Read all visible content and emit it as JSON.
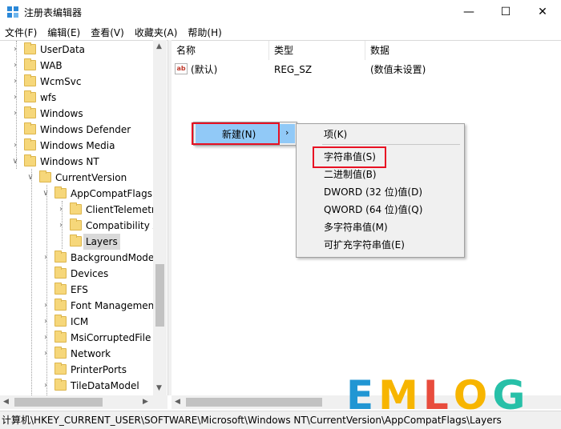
{
  "window": {
    "title": "注册表编辑器",
    "minimize": "—",
    "maximize": "☐",
    "close": "✕"
  },
  "menubar": [
    "文件(F)",
    "编辑(E)",
    "查看(V)",
    "收藏夹(A)",
    "帮助(H)"
  ],
  "tree": {
    "items": [
      {
        "label": "UserData",
        "state": "collapsed"
      },
      {
        "label": "WAB",
        "state": "collapsed"
      },
      {
        "label": "WcmSvc",
        "state": "collapsed"
      },
      {
        "label": "wfs",
        "state": "collapsed"
      },
      {
        "label": "Windows",
        "state": "collapsed"
      },
      {
        "label": "Windows Defender",
        "state": "none"
      },
      {
        "label": "Windows Media",
        "state": "collapsed"
      },
      {
        "label": "Windows NT",
        "state": "expanded"
      },
      {
        "label": "CurrentVersion",
        "state": "expanded"
      },
      {
        "label": "AppCompatFlags",
        "state": "expanded"
      },
      {
        "label": "ClientTelemetr",
        "state": "collapsed"
      },
      {
        "label": "Compatibility A",
        "state": "collapsed"
      },
      {
        "label": "Layers",
        "state": "selected"
      },
      {
        "label": "BackgroundMode",
        "state": "collapsed"
      },
      {
        "label": "Devices",
        "state": "none"
      },
      {
        "label": "EFS",
        "state": "none"
      },
      {
        "label": "Font Managemen",
        "state": "collapsed"
      },
      {
        "label": "ICM",
        "state": "collapsed"
      },
      {
        "label": "MsiCorruptedFile",
        "state": "collapsed"
      },
      {
        "label": "Network",
        "state": "collapsed"
      },
      {
        "label": "PrinterPorts",
        "state": "none"
      },
      {
        "label": "TileDataModel",
        "state": "collapsed"
      }
    ]
  },
  "list": {
    "columns": [
      "名称",
      "类型",
      "数据"
    ],
    "rows": [
      {
        "icon": "ab",
        "name": "(默认)",
        "type": "REG_SZ",
        "data": "(数值未设置)"
      }
    ]
  },
  "context_menu": {
    "new_label": "新建(N)",
    "arrow": "›"
  },
  "submenu": {
    "items": [
      "项(K)",
      "字符串值(S)",
      "二进制值(B)",
      "DWORD (32 位)值(D)",
      "QWORD (64 位)值(Q)",
      "多字符串值(M)",
      "可扩充字符串值(E)"
    ]
  },
  "statusbar": {
    "path": "计算机\\HKEY_CURRENT_USER\\SOFTWARE\\Microsoft\\Windows NT\\CurrentVersion\\AppCompatFlags\\Layers"
  },
  "watermark": {
    "letters": [
      {
        "char": "E",
        "color": "#2196d3"
      },
      {
        "char": "M",
        "color": "#f7b500"
      },
      {
        "char": "L",
        "color": "#e84c3d"
      },
      {
        "char": "O",
        "color": "#f7b500"
      },
      {
        "char": "G",
        "color": "#27c0a8"
      }
    ]
  },
  "colors": {
    "highlight_box": "#e81123",
    "menu_hover": "#91c9f7",
    "folder": "#f6d77a"
  }
}
